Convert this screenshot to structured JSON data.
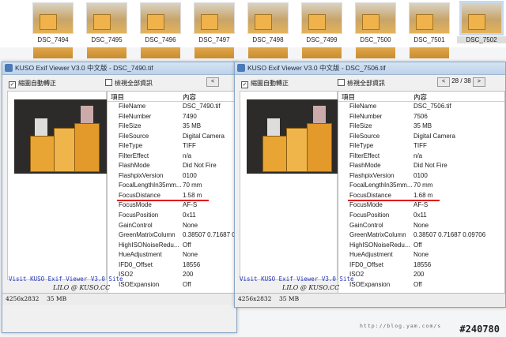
{
  "thumbnails": [
    {
      "label": "DSC_7494"
    },
    {
      "label": "DSC_7495"
    },
    {
      "label": "DSC_7496"
    },
    {
      "label": "DSC_7497"
    },
    {
      "label": "DSC_7498"
    },
    {
      "label": "DSC_7499"
    },
    {
      "label": "DSC_7500"
    },
    {
      "label": "DSC_7501"
    },
    {
      "label": "DSC_7502"
    }
  ],
  "window1": {
    "title": "KUSO Exif Viewer V3.0 中文版 - DSC_7490.tif",
    "auto_rotate": "縮圖自動轉正",
    "show_all": "檢視全部資訊",
    "header_item": "項目",
    "header_content": "內容",
    "rows": [
      {
        "k": "FileName",
        "v": "DSC_7490.tif"
      },
      {
        "k": "FileNumber",
        "v": "7490"
      },
      {
        "k": "FileSize",
        "v": "35 MB"
      },
      {
        "k": "FileSource",
        "v": "Digital Camera"
      },
      {
        "k": "FileType",
        "v": "TIFF"
      },
      {
        "k": "FilterEffect",
        "v": "n/a"
      },
      {
        "k": "FlashMode",
        "v": "Did Not Fire"
      },
      {
        "k": "FlashpixVersion",
        "v": "0100"
      },
      {
        "k": "FocalLengthIn35mm...",
        "v": "70 mm"
      },
      {
        "k": "FocusDistance",
        "v": "1.58 m"
      },
      {
        "k": "FocusMode",
        "v": "AF-S"
      },
      {
        "k": "FocusPosition",
        "v": "0x11"
      },
      {
        "k": "GainControl",
        "v": "None"
      },
      {
        "k": "GreenMatrixColumn",
        "v": "0.38507 0.71687 0.0"
      },
      {
        "k": "HighISONoiseRedu...",
        "v": "Off"
      },
      {
        "k": "HueAdjustment",
        "v": "None"
      },
      {
        "k": "IFD0_Offset",
        "v": "18556"
      },
      {
        "k": "ISO2",
        "v": "200"
      },
      {
        "k": "ISOExpansion",
        "v": "Off"
      }
    ],
    "site_link": "Visit KUSO Exif Viewer V3.0 Site",
    "lilo": "LILO @ KUSO.CC",
    "status_size": "4256x2832",
    "status_file": "35 MB"
  },
  "window2": {
    "title": "KUSO Exif Viewer V3.0 中文版 - DSC_7506.tif",
    "auto_rotate": "縮圖自動轉正",
    "show_all": "檢視全部資訊",
    "counter": "28 / 38",
    "header_item": "項目",
    "header_content": "內容",
    "rows": [
      {
        "k": "FileName",
        "v": "DSC_7506.tif"
      },
      {
        "k": "FileNumber",
        "v": "7506"
      },
      {
        "k": "FileSize",
        "v": "35 MB"
      },
      {
        "k": "FileSource",
        "v": "Digital Camera"
      },
      {
        "k": "FileType",
        "v": "TIFF"
      },
      {
        "k": "FilterEffect",
        "v": "n/a"
      },
      {
        "k": "FlashMode",
        "v": "Did Not Fire"
      },
      {
        "k": "FlashpixVersion",
        "v": "0100"
      },
      {
        "k": "FocalLengthIn35mm...",
        "v": "70 mm"
      },
      {
        "k": "FocusDistance",
        "v": "1.68 m"
      },
      {
        "k": "FocusMode",
        "v": "AF-S"
      },
      {
        "k": "FocusPosition",
        "v": "0x11"
      },
      {
        "k": "GainControl",
        "v": "None"
      },
      {
        "k": "GreenMatrixColumn",
        "v": "0.38507 0.71687 0.09706"
      },
      {
        "k": "HighISONoiseRedu...",
        "v": "Off"
      },
      {
        "k": "HueAdjustment",
        "v": "None"
      },
      {
        "k": "IFD0_Offset",
        "v": "18556"
      },
      {
        "k": "ISO2",
        "v": "200"
      },
      {
        "k": "ISOExpansion",
        "v": "Off"
      }
    ],
    "site_link": "Visit KUSO Exif Viewer V3.0 Site",
    "lilo": "LILO @ KUSO.CC",
    "status_size": "4256x2832",
    "status_file": "35 MB"
  },
  "blog_url": "http://blog.yam.com/s",
  "watermark": "#240780",
  "colors": {
    "highlight": "#dd1111",
    "link": "#2a3bb0"
  }
}
